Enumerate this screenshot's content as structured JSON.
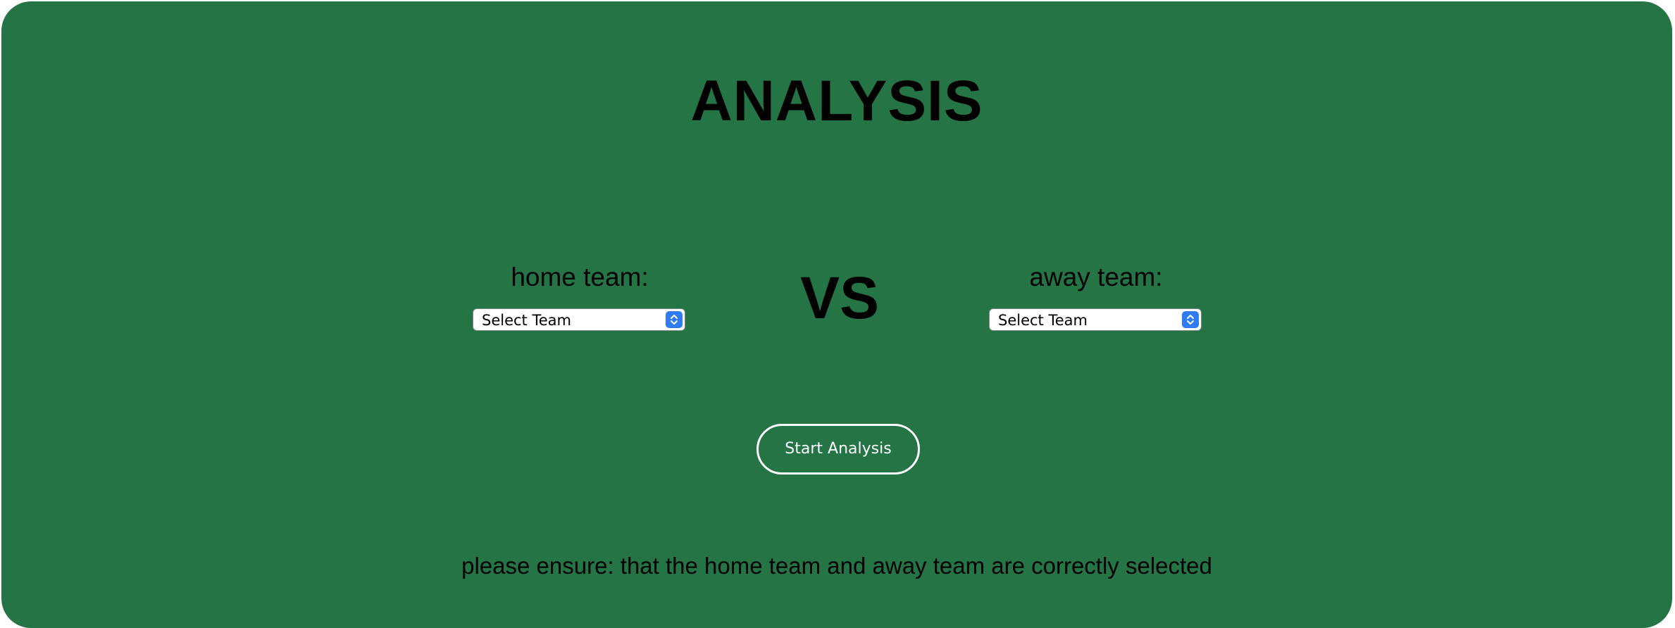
{
  "page": {
    "title": "ANALYSIS",
    "background_color": "#257446"
  },
  "home": {
    "label": "home team:",
    "select_value": "Select Team"
  },
  "vs_text": "VS",
  "away": {
    "label": "away team:",
    "select_value": "Select Team"
  },
  "start_button": {
    "label": "Start Analysis"
  },
  "note": "please ensure: that the home team and away team are correctly selected",
  "colors": {
    "select_accent": "#2f7cf6",
    "button_border": "#ffffff"
  }
}
